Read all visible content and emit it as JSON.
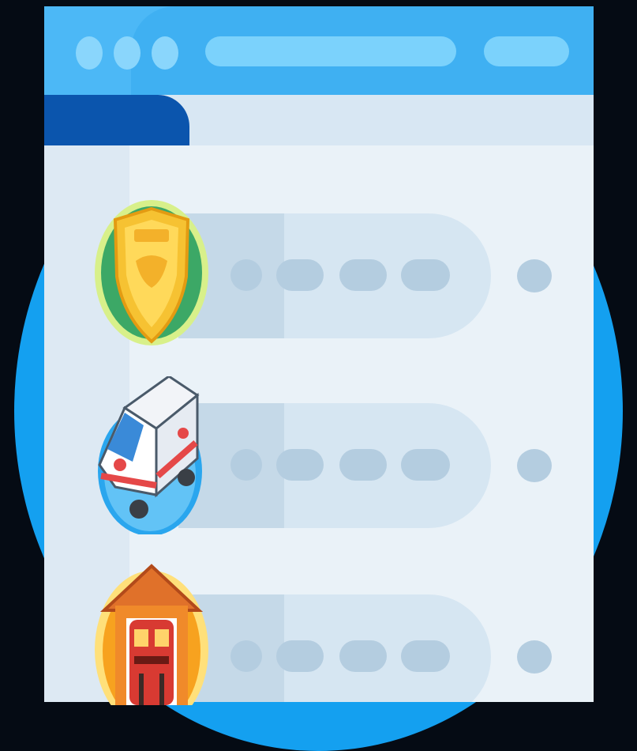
{
  "colors": {
    "background": "#050b14",
    "glow": "#14a0f0",
    "titlebar": "#4cb8f6",
    "active_tab": "#0b55ad",
    "window": "#eaf2f8",
    "row_pill": "#d6e6f2",
    "placeholder": "#b4cde0"
  },
  "icons": [
    "police-badge-icon",
    "ambulance-icon",
    "fire-station-icon"
  ],
  "rows": [
    {
      "icon": "police-badge-icon",
      "accent": "#3ca866"
    },
    {
      "icon": "ambulance-icon",
      "accent": "#2aa6ee"
    },
    {
      "icon": "fire-station-icon",
      "accent": "#f7a21f"
    }
  ]
}
